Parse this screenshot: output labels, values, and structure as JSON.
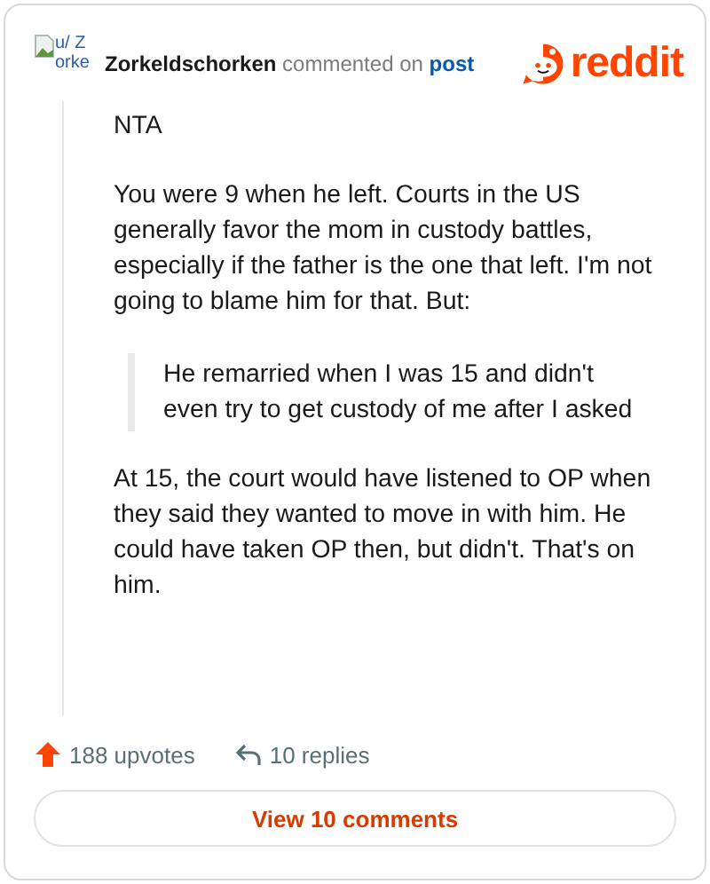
{
  "header": {
    "avatar_alt": "u/ Zorke",
    "author": "Zorkeldschorken",
    "action": "commented on",
    "link": "post",
    "logo": "reddit"
  },
  "body": [
    {
      "kind": "paragraph",
      "text": "NTA"
    },
    {
      "kind": "paragraph",
      "text": "You were 9 when he left. Courts in the US generally favor the mom in custody battles, especially if the father is the one that left. I'm not going to blame him for that. But:"
    },
    {
      "kind": "quote",
      "text": "He remarried when I was 15 and didn't even try to get custody of me after I asked"
    },
    {
      "kind": "paragraph",
      "text": "At 15, the court would have listened to OP when they said they wanted to move in with him. He could have taken OP then, but didn't. That's on him."
    }
  ],
  "footer": {
    "upvotes": "188 upvotes",
    "replies": "10 replies",
    "button": "View 10 comments"
  }
}
